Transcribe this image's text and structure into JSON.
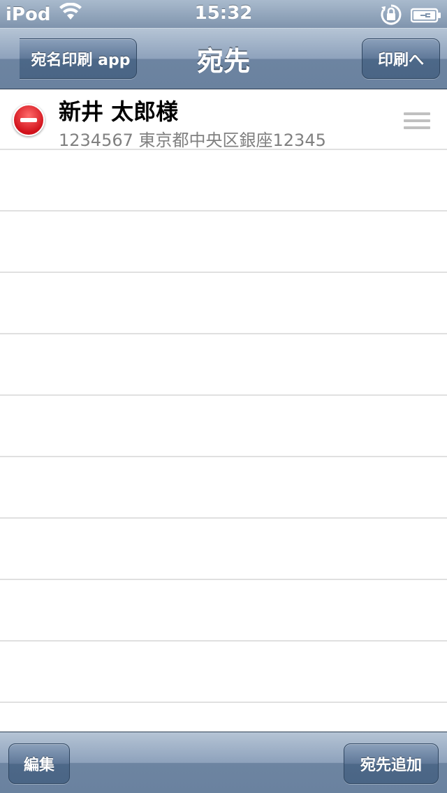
{
  "status_bar": {
    "carrier": "iPod",
    "time": "15:32"
  },
  "nav": {
    "back_label": "宛名印刷 app",
    "title": "宛先",
    "print_label": "印刷へ"
  },
  "entries": [
    {
      "name": "新井 太郎様",
      "address": "1234567 東京都中央区銀座12345"
    }
  ],
  "toolbar": {
    "edit_label": "編集",
    "add_label": "宛先追加"
  },
  "colors": {
    "bar_blue": "#6d84a1",
    "delete_red": "#d1121b",
    "separator": "#e0e0e0"
  }
}
